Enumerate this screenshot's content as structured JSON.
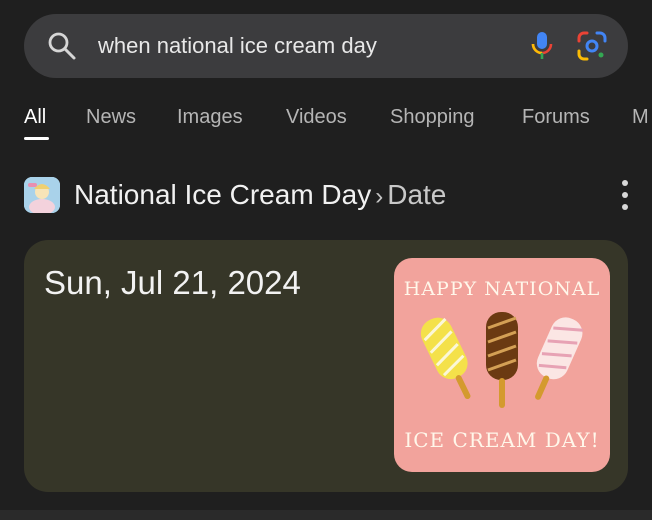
{
  "search": {
    "query": "when national ice cream day"
  },
  "tabs": [
    {
      "label": "All",
      "active": true
    },
    {
      "label": "News"
    },
    {
      "label": "Images"
    },
    {
      "label": "Videos"
    },
    {
      "label": "Shopping"
    },
    {
      "label": "Forums"
    },
    {
      "label": "M"
    }
  ],
  "result": {
    "title": "National Ice Cream Day",
    "separator": "›",
    "crumb": "Date",
    "date": "Sun, Jul 21, 2024",
    "image_text_top": "HAPPY NATIONAL",
    "image_text_bottom": "ICE CREAM DAY!"
  },
  "icons": {
    "search": "magnifier-icon",
    "voice": "microphone-icon",
    "lens": "google-lens-icon",
    "menu": "more-vert-icon"
  },
  "colors": {
    "background": "#1f1f1f",
    "search_bar": "#3c3c3e",
    "card": "#363628",
    "thumbnail": "#f2a39c"
  }
}
